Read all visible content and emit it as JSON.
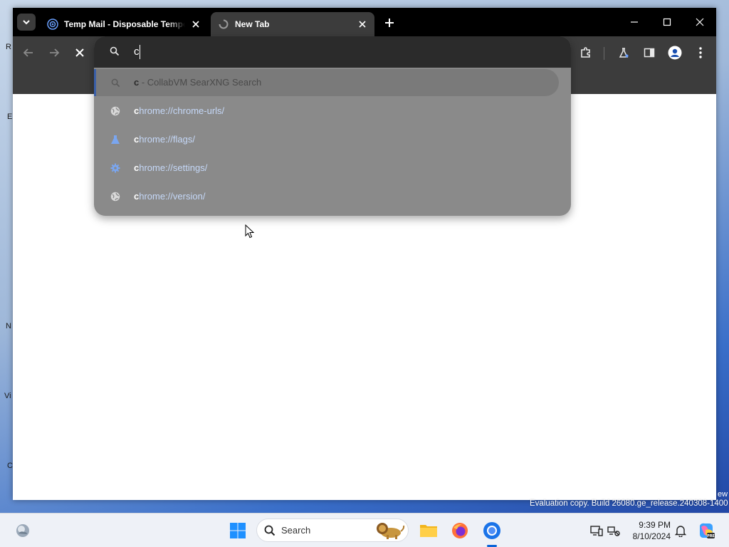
{
  "browser": {
    "tabs": [
      {
        "title": "Temp Mail - Disposable Temporary Email",
        "active": false
      },
      {
        "title": "New Tab",
        "active": true
      }
    ]
  },
  "omnibox": {
    "typed_text": "c",
    "suggestions": [
      {
        "icon": "search-icon",
        "bold": "c",
        "rest": " - CollabVM SearXNG Search",
        "selected": true
      },
      {
        "icon": "globe-icon",
        "bold": "c",
        "rest": "hrome://chrome-urls/",
        "selected": false
      },
      {
        "icon": "flask-icon",
        "bold": "c",
        "rest": "hrome://flags/",
        "selected": false
      },
      {
        "icon": "gear-icon",
        "bold": "c",
        "rest": "hrome://settings/",
        "selected": false
      },
      {
        "icon": "globe-icon",
        "bold": "c",
        "rest": "hrome://version/",
        "selected": false
      }
    ]
  },
  "watermark": {
    "text": "Evaluation copy. Build 26080.ge_release.240308-1400",
    "edge_fragment": "ew"
  },
  "taskbar": {
    "search_label": "Search",
    "time": "9:39 PM",
    "date": "8/10/2024"
  },
  "desktop_fragments": [
    "R",
    "E",
    "N",
    "Vi",
    "C"
  ],
  "colors": {
    "tabstrip": "#000000",
    "toolbar": "#3c3c3c",
    "omnibox_popup": "#8a8a8a",
    "selection_accent": "#3a5fa8",
    "url_text": "#c5d8f8"
  }
}
